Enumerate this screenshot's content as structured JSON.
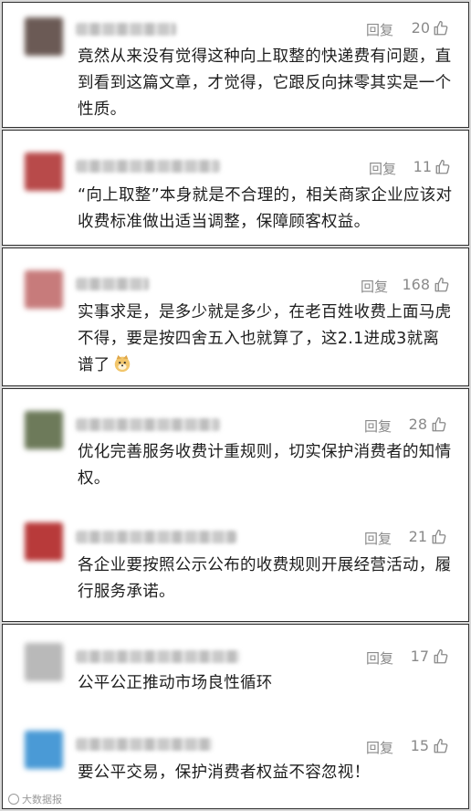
{
  "reply_label": "回复",
  "comments": [
    {
      "text": "竟然从来没有觉得这种向上取整的快递费有问题，直到看到这篇文章，才觉得，它跟反向抹零其实是一个性质。",
      "likes": "20",
      "avatar_color": "#6b5a55"
    },
    {
      "text": "“向上取整”本身就是不合理的，相关商家企业应该对收费标准做出适当调整，保障顾客权益。",
      "likes": "11",
      "avatar_color": "#b84a4a"
    },
    {
      "text": "实事求是，是多少就是多少，在老百姓收费上面马虎不得，要是按四舍五入也就算了，这2.1进成3就离谱了",
      "likes": "168",
      "avatar_color": "#c77b7b",
      "emoji": "doge-emoji"
    },
    {
      "text": "优化完善服务收费计重规则，切实保护消费者的知情权。",
      "likes": "28",
      "avatar_color": "#6d7a5a"
    },
    {
      "text": "各企业要按照公示公布的收费规则开展经营活动，履行服务承诺。",
      "likes": "21",
      "avatar_color": "#b83a3a"
    },
    {
      "text": "公平公正推动市场良性循环",
      "likes": "17",
      "avatar_color": "#b9b9b9"
    },
    {
      "text": "要公平交易，保护消费者权益不容忽视！",
      "likes": "15",
      "avatar_color": "#4a9ad6"
    }
  ],
  "watermark": "大数据报",
  "icons": {
    "like": "thumbs-up-icon",
    "watermark": "watermark-logo-icon"
  }
}
